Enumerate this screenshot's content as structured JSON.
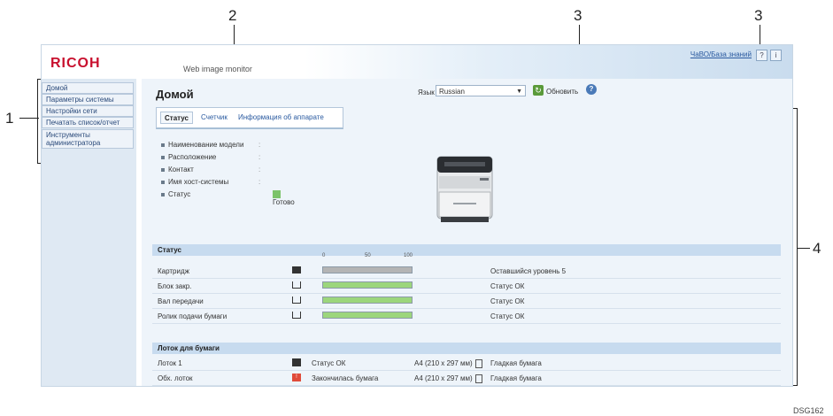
{
  "callouts": [
    "1",
    "2",
    "3",
    "3",
    "4"
  ],
  "header": {
    "logo": "RICOH",
    "product": "Web image monitor",
    "help_link": "ЧаВО/База знаний",
    "icon1": "?",
    "icon2": "i"
  },
  "sidebar": {
    "items": [
      {
        "label": "Домой"
      },
      {
        "label": "Параметры системы"
      },
      {
        "label": "Настройки сети"
      },
      {
        "label": "Печатать список/отчет"
      },
      {
        "label": "Инструменты администратора"
      }
    ]
  },
  "main": {
    "title": "Домой",
    "language_label": "Язык",
    "language_value": "Russian",
    "refresh_label": "Обновить",
    "help_icon": "?",
    "tabs": [
      {
        "label": "Статус"
      },
      {
        "label": "Счетчик"
      },
      {
        "label": "Информация об аппарате"
      }
    ],
    "info": [
      {
        "label": "Наименование модели",
        "value": ":"
      },
      {
        "label": "Расположение",
        "value": ":"
      },
      {
        "label": "Контакт",
        "value": ":"
      },
      {
        "label": "Имя хост-системы",
        "value": ":"
      },
      {
        "label": "Статус",
        "value": "Готово"
      }
    ]
  },
  "status_section": {
    "title": "Статус",
    "scale": [
      "0",
      "50",
      "100"
    ],
    "rows": [
      {
        "name": "Картридж",
        "status": "Оставшийся уровень 5",
        "fill": 1.0,
        "color": "#b4b4b4"
      },
      {
        "name": "Блок закр.",
        "status": "Статус ОК",
        "fill": 1.0,
        "color": "#9cd67c"
      },
      {
        "name": "Вал передачи",
        "status": "Статус ОК",
        "fill": 1.0,
        "color": "#9cd67c"
      },
      {
        "name": "Ролик подачи бумаги",
        "status": "Статус ОК",
        "fill": 1.0,
        "color": "#9cd67c"
      }
    ]
  },
  "tray_section": {
    "title": "Лоток для бумаги",
    "rows": [
      {
        "name": "Лоток 1",
        "status": "Статус ОК",
        "size": "A4 (210 x 297 мм)",
        "type": "Гладкая бумага"
      },
      {
        "name": "Обх. лоток",
        "status": "Закончилась бумага",
        "size": "A4 (210 x 297 мм)",
        "type": "Гладкая бумага"
      }
    ]
  },
  "footer_code": "DSG162"
}
